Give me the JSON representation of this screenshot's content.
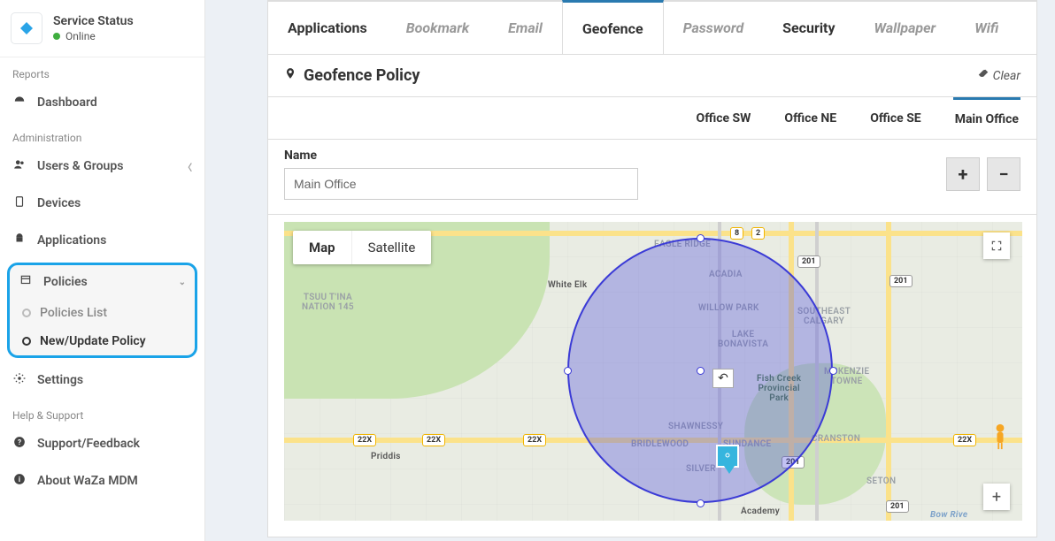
{
  "sidebar": {
    "status_title": "Service Status",
    "status_text": "Online",
    "sections": {
      "reports": "Reports",
      "administration": "Administration",
      "help": "Help & Support"
    },
    "items": {
      "dashboard": "Dashboard",
      "users_groups": "Users & Groups",
      "devices": "Devices",
      "applications": "Applications",
      "policies": "Policies",
      "policies_list": "Policies List",
      "new_update_policy": "New/Update Policy",
      "settings": "Settings",
      "support": "Support/Feedback",
      "about": "About WaZa MDM"
    }
  },
  "tabs": {
    "applications": "Applications",
    "bookmark": "Bookmark",
    "email": "Email",
    "geofence": "Geofence",
    "password": "Password",
    "security": "Security",
    "wallpaper": "Wallpaper",
    "wifi": "Wifi"
  },
  "panel": {
    "title": "Geofence Policy",
    "clear": "Clear",
    "subtabs": {
      "office_sw": "Office SW",
      "office_ne": "Office NE",
      "office_se": "Office SE",
      "main_office": "Main Office"
    },
    "name_label": "Name",
    "name_value": "Main Office"
  },
  "map": {
    "map_btn": "Map",
    "satellite_btn": "Satellite",
    "labels": {
      "tsuu": "TSUU T'INA\nNATION 145",
      "white_elk": "White Elk",
      "eagle_ridge": "EAGLE RIDGE",
      "acadia": "ACADIA",
      "willow_park": "WILLOW PARK",
      "lake_bona": "LAKE\nBONAVISTA",
      "se_calgary": "SOUTHEAST\nCALGARY",
      "mckenzie": "MCKENZIE\nTOWNE",
      "fish_creek": "Fish Creek\nProvincial\nPark",
      "shawnessy": "SHAWNESSY",
      "bridlewood": "BRIDLEWOOD",
      "sundance": "SUNDANCE",
      "silver": "SILVER",
      "cranston": "CRANSTON",
      "seton": "SETON",
      "priddis": "Priddis",
      "academy": "Academy",
      "bow": "Bow Rive"
    },
    "routes": [
      "8",
      "2",
      "201",
      "201",
      "22X",
      "22X",
      "22X",
      "22X",
      "201",
      "201"
    ]
  }
}
